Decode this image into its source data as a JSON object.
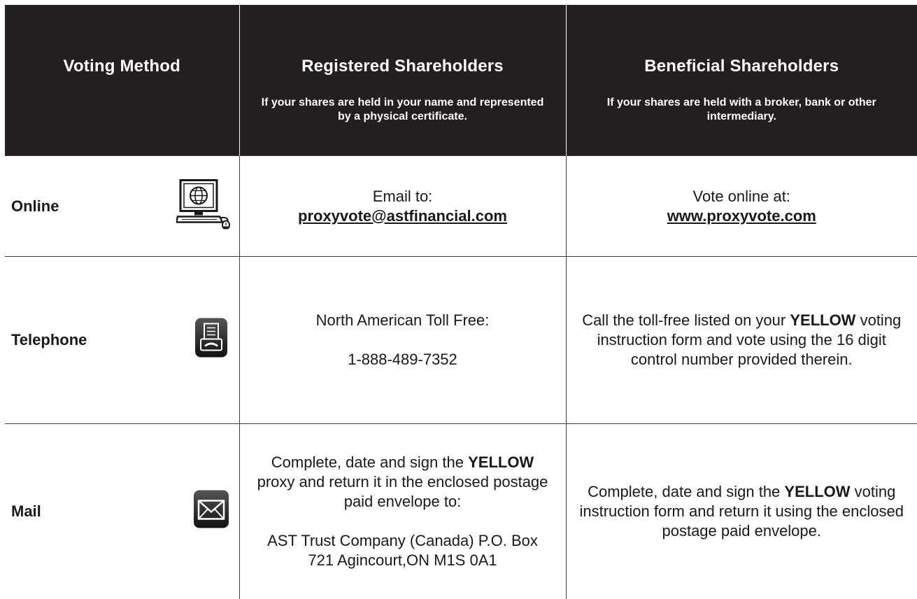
{
  "header": {
    "method": "Voting Method",
    "registered_title": "Registered Shareholders",
    "registered_sub": "If your shares are held in your name and represented by a physical certificate.",
    "beneficial_title": "Beneficial Shareholders",
    "beneficial_sub": "If your shares are held with a broker, bank or other intermediary."
  },
  "online": {
    "label": "Online",
    "icon": "computer-icon",
    "reg_line1": "Email to:",
    "reg_link": "proxyvote@astfinancial.com",
    "ben_line1": "Vote online at:",
    "ben_link": "www.proxyvote.com"
  },
  "telephone": {
    "label": "Telephone",
    "icon": "telephone-icon",
    "reg_line1": "North American Toll Free:",
    "reg_number": "1-888-489-7352",
    "ben_pre": "Call the toll-free listed on your",
    "ben_bold": "YELLOW",
    "ben_post": "voting instruction form and vote using the 16 digit control number provided therein."
  },
  "mail": {
    "label": "Mail",
    "icon": "envelope-icon",
    "reg_pre": "Complete, date and sign the",
    "reg_bold": "YELLOW",
    "reg_post": "proxy and return it in the enclosed postage paid envelope to:",
    "reg_address": "AST Trust Company (Canada) P.O. Box 721 Agincourt,ON M1S 0A1",
    "ben_pre": "Complete, date and sign the",
    "ben_bold": "YELLOW",
    "ben_post": "voting instruction form and return it using the enclosed postage paid envelope."
  }
}
